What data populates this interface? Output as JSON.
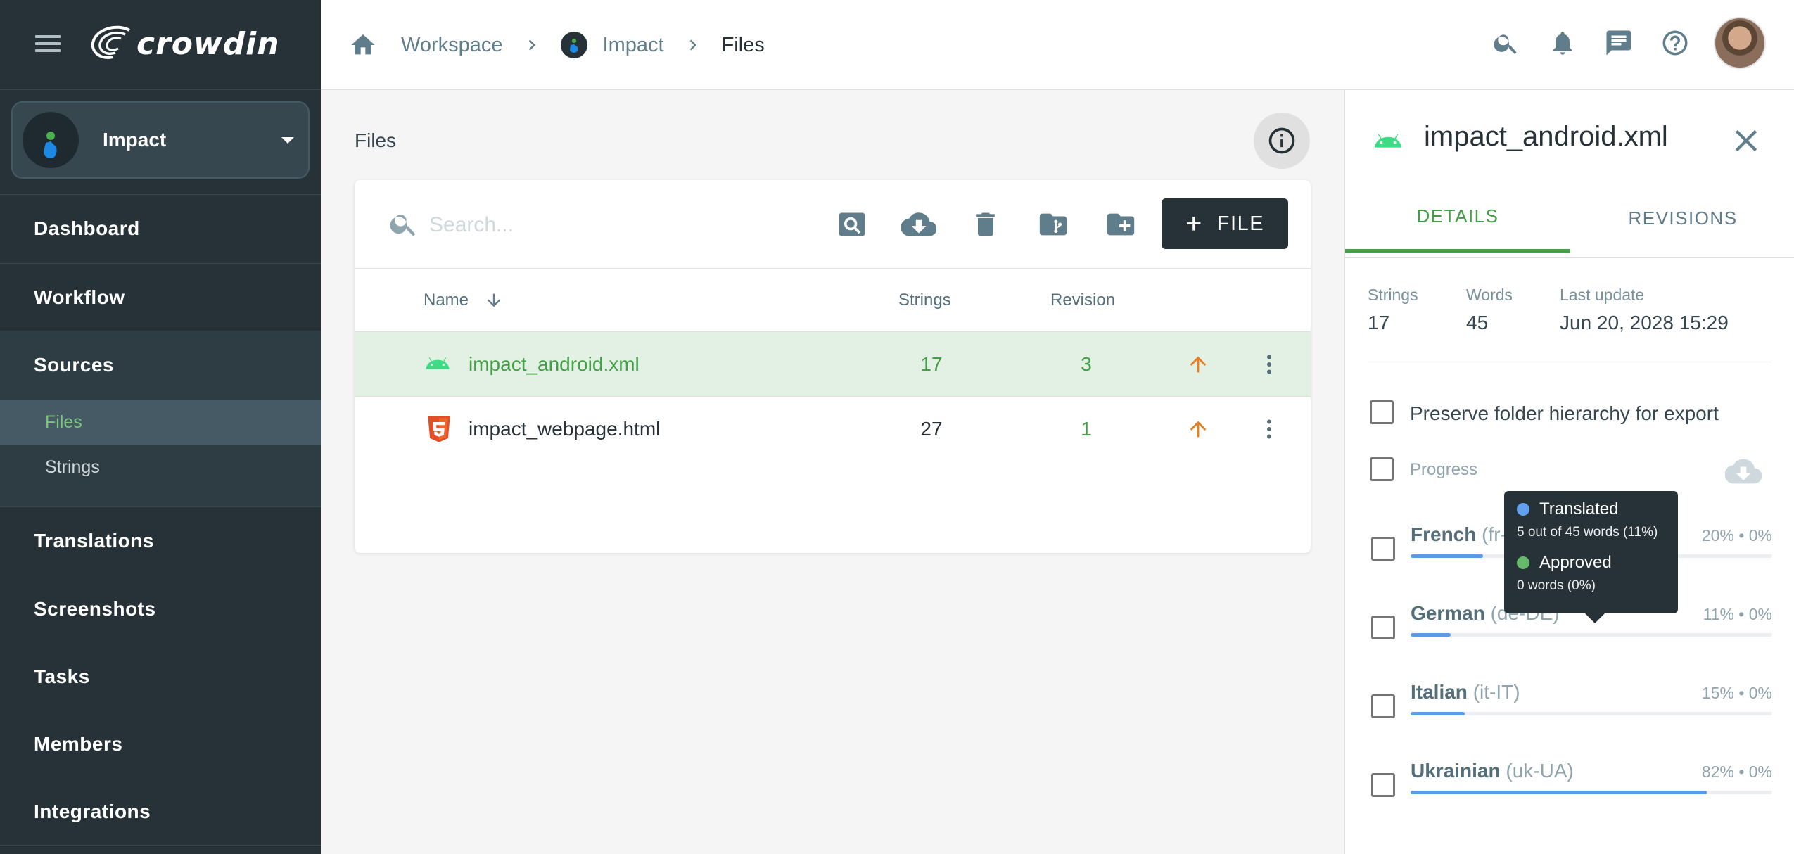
{
  "app": {
    "logo_text": "crowdin"
  },
  "project": {
    "name": "Impact"
  },
  "sidebar": {
    "items": [
      {
        "label": "Dashboard"
      },
      {
        "label": "Workflow"
      },
      {
        "label": "Sources"
      },
      {
        "label": "Translations"
      },
      {
        "label": "Screenshots"
      },
      {
        "label": "Tasks"
      },
      {
        "label": "Members"
      },
      {
        "label": "Integrations"
      }
    ],
    "sources_sub": [
      {
        "label": "Files"
      },
      {
        "label": "Strings"
      }
    ]
  },
  "breadcrumb": {
    "workspace": "Workspace",
    "project": "Impact",
    "current": "Files"
  },
  "main": {
    "heading": "Files",
    "search_placeholder": "Search...",
    "add_file_label": "FILE",
    "columns": {
      "name": "Name",
      "strings": "Strings",
      "revision": "Revision"
    },
    "files": [
      {
        "name": "impact_android.xml",
        "strings": "17",
        "revision": "3",
        "icon": "android-icon"
      },
      {
        "name": "impact_webpage.html",
        "strings": "27",
        "revision": "1",
        "icon": "html5-icon"
      }
    ]
  },
  "panel": {
    "title": "impact_android.xml",
    "tabs": {
      "details": "DETAILS",
      "revisions": "REVISIONS"
    },
    "stats": {
      "strings_label": "Strings",
      "strings_value": "17",
      "words_label": "Words",
      "words_value": "45",
      "updated_label": "Last update",
      "updated_value": "Jun 20, 2028 15:29"
    },
    "preserve_label": "Preserve folder hierarchy for export",
    "progress_label": "Progress",
    "languages": [
      {
        "name": "French",
        "code": "(fr-FR)",
        "pct": "20% • 0%",
        "progress": 0.2
      },
      {
        "name": "German",
        "code": "(de-DE)",
        "pct": "11% • 0%",
        "progress": 0.11
      },
      {
        "name": "Italian",
        "code": "(it-IT)",
        "pct": "15% • 0%",
        "progress": 0.15
      },
      {
        "name": "Ukrainian",
        "code": "(uk-UA)",
        "pct": "82% • 0%",
        "progress": 0.82
      }
    ]
  },
  "tooltip": {
    "translated_label": "Translated",
    "translated_detail": "5 out of 45 words (11%)",
    "approved_label": "Approved",
    "approved_detail": "0 words (0%)"
  },
  "colors": {
    "accent_green": "#43a047",
    "sidebar_bg": "#263238",
    "progress_blue": "#5c9ce6",
    "upload_arrow": "#e67e22",
    "approved_dot": "#66bb6a",
    "translated_dot": "#64a0f0"
  }
}
